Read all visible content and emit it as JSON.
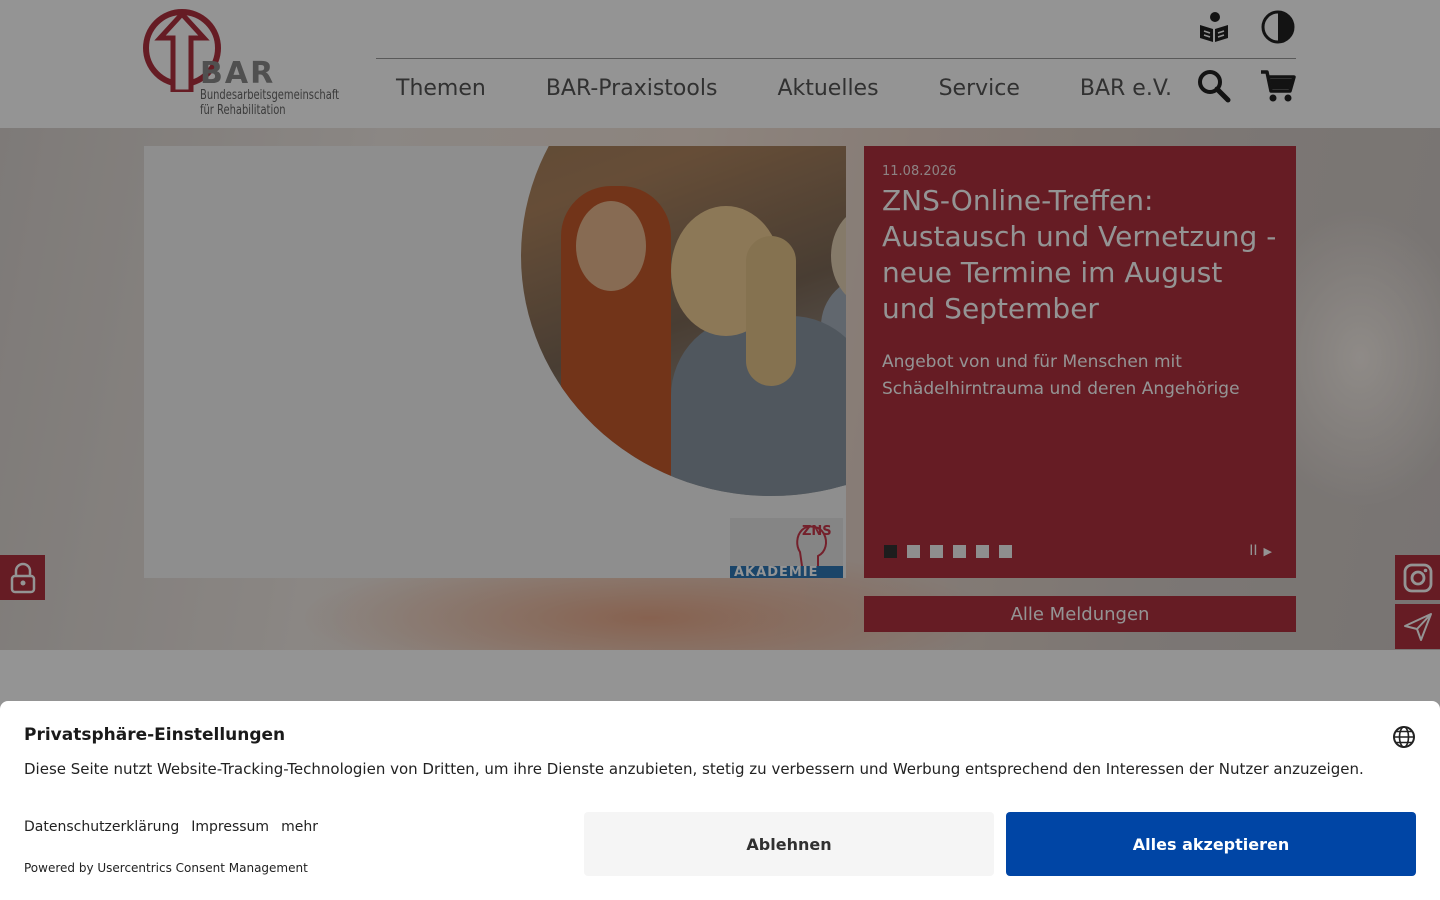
{
  "header": {
    "logo": {
      "wordmark": "BAR",
      "subtitle_line1": "Bundesarbeitsgemeinschaft",
      "subtitle_line2": "für Rehabilitation",
      "brand_color": "#b0313f"
    },
    "top_icons": [
      "easy-language-icon",
      "contrast-icon"
    ],
    "nav": [
      {
        "label": "Themen"
      },
      {
        "label": "BAR-Praxistools"
      },
      {
        "label": "Aktuelles"
      },
      {
        "label": "Service"
      },
      {
        "label": "BAR e.V."
      }
    ],
    "nav_tools": [
      "search-icon",
      "cart-icon"
    ]
  },
  "slider": {
    "image_badge": {
      "logo_text": "ZNS",
      "banner_text": "AKADEMIE"
    },
    "current": {
      "date": "11.08.2026",
      "title": "ZNS-Online-Treffen: Austausch und Vernetzung - neue Termine im August und September",
      "teaser": "Angebot von und für Menschen mit Schädelhirntrauma und deren Angehörige"
    },
    "dot_count": 6,
    "active_dot": 1,
    "controls": {
      "pause": "II",
      "next": "▶"
    },
    "all_news_label": "Alle Meldungen",
    "accent_color": "#b0313f"
  },
  "side_buttons": {
    "left": [
      "lock-icon"
    ],
    "right": [
      "instagram-icon",
      "send-icon"
    ]
  },
  "consent": {
    "title": "Privatsphäre-Einstellungen",
    "text": "Diese Seite nutzt Website-Tracking-Technologien von Dritten, um ihre Dienste anzubieten, stetig zu verbessern und Werbung entsprechend den Interessen der Nutzer anzuzeigen.",
    "links": [
      "Datenschutzerklärung",
      "Impressum",
      "mehr"
    ],
    "powered_by": "Powered by Usercentrics Consent Management",
    "deny_label": "Ablehnen",
    "accept_label": "Alles akzeptieren",
    "accept_color": "#0045a5",
    "language_icon": "globe-icon"
  }
}
